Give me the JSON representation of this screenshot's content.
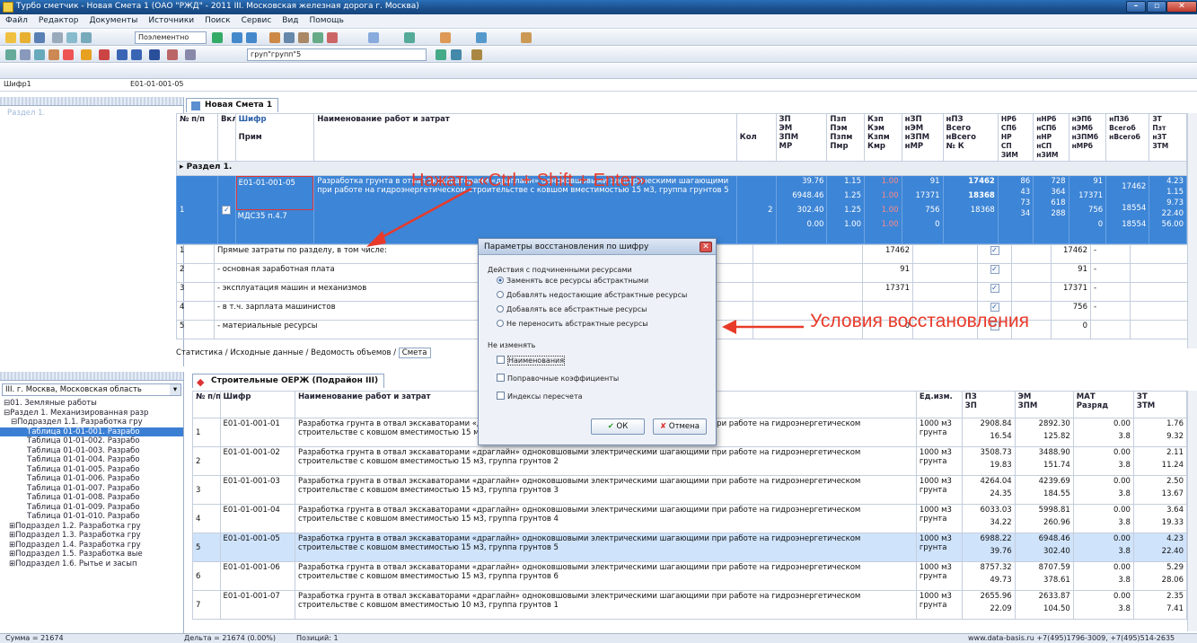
{
  "window": {
    "title": "Турбо сметчик - Новая Смета 1 (ОАО \"РЖД\" - 2011 III. Московская железная дорога г. Москва)",
    "min": "–",
    "max": "▫",
    "close": "✕"
  },
  "menu": [
    "Файл",
    "Редактор",
    "Документы",
    "Источники",
    "Поиск",
    "Сервис",
    "Вид",
    "Помощь"
  ],
  "toolbar": {
    "combo1": "Поэлементно",
    "combo2": "груп\"групп\"5"
  },
  "addr": {
    "label": "Шифр1",
    "value": "E01-01-001-05"
  },
  "left_top": {
    "items": [
      "Раздел 1."
    ]
  },
  "left_bottom": {
    "dropdown": "III. г. Москва, Московская область",
    "tree": [
      "⊟01. Земляные работы",
      "⊟Раздел 1. Механизированная разр",
      "⊟Подраздел 1.1. Разработка гру",
      "Таблица 01-01-001. Разрабо",
      "Таблица 01-01-002. Разрабо",
      "Таблица 01-01-003. Разрабо",
      "Таблица 01-01-004. Разрабо",
      "Таблица 01-01-005. Разрабо",
      "Таблица 01-01-006. Разрабо",
      "Таблица 01-01-007. Разрабо",
      "Таблица 01-01-008. Разрабо",
      "Таблица 01-01-009. Разрабо",
      "Таблица 01-01-010. Разрабо",
      "⊞Подраздел 1.2. Разработка гру",
      "⊞Подраздел 1.3. Разработка гру",
      "⊞Подраздел 1.4. Разработка гру",
      "⊞Подраздел 1.5. Разработка вые",
      "⊞Подраздел 1.6. Рытье и засып"
    ]
  },
  "top_tab": "Новая Смета 1",
  "top_header": {
    "no": "№ п/п",
    "vkl": "Вкл",
    "shifr": "Шифр",
    "prim": "Прим",
    "name": "Наименование работ и затрат",
    "kol": "Кол",
    "c1": [
      "ЗП",
      "ЭМ",
      "ЗПМ",
      "МР"
    ],
    "c2": [
      "Пзп",
      "Пэм",
      "Пзпм",
      "Пмр"
    ],
    "c3": [
      "Кзп",
      "Кэм",
      "Кзпм",
      "Кмр"
    ],
    "c4": [
      "нЗП",
      "нЭМ",
      "нЗПМ",
      "нМР"
    ],
    "c5": [
      "нПЗ",
      "Всего",
      "нВсего",
      "№ К"
    ],
    "c6": [
      "НРб",
      "СПб",
      "НР",
      "СП",
      "ЗИМ"
    ],
    "c7": [
      "нНРб",
      "нСПб",
      "нНР",
      "нСП",
      "нЗИМ"
    ],
    "c8": [
      "нЭПб",
      "нЭМб",
      "нЗПМб",
      "нМРб"
    ],
    "c9": [
      "нПЗб",
      "Всегоб",
      "нВсегоб"
    ],
    "c10": [
      "ЗТ",
      "Пзт",
      "нЗТ",
      "ЗТМ",
      "нЗТМ"
    ]
  },
  "section_label": "Раздел 1.",
  "main_row": {
    "no": "1",
    "code": "E01-01-001-05",
    "prim": "МДС35 п.4.7",
    "name": "Разработка грунта в отвал экскаваторами «драглайн» одноковшовыми электрическими шагающими при работе на гидроэнергетическом строительстве с ковшом вместимостью 15 м3, группа грунтов 5",
    "kol": "2",
    "c1": [
      "39.76",
      "6948.46",
      "302.40",
      "0.00"
    ],
    "c2": [
      "1.15",
      "1.25",
      "1.25",
      "1.00"
    ],
    "c3": [
      "1.00",
      "1.00",
      "1.00",
      "1.00"
    ],
    "c4": [
      "91",
      "17371",
      "756",
      "0"
    ],
    "c5": [
      "17462",
      "18368",
      "18368"
    ],
    "c6": [
      "86",
      "43",
      "73",
      "34"
    ],
    "c7": [
      "728",
      "364",
      "618",
      "288"
    ],
    "c8": [
      "91",
      "17371",
      "756",
      "0"
    ],
    "c9": [
      "17462",
      "18554",
      "18554"
    ],
    "c10": [
      "4.23",
      "1.15",
      "9.73",
      "22.40",
      "56.00"
    ]
  },
  "summary_rows": [
    {
      "no": "1",
      "label": "Прямые затраты по разделу, в том числе:",
      "v": "17462",
      "b": "17462",
      "z": "-"
    },
    {
      "no": "2",
      "label": "- основная заработная плата",
      "v": "91",
      "b": "91",
      "z": "-"
    },
    {
      "no": "3",
      "label": "- эксплуатация машин и механизмов",
      "v": "17371",
      "b": "17371",
      "z": "-"
    },
    {
      "no": "4",
      "label": "- в т.ч. зарплата машинистов",
      "v": "",
      "b": "756",
      "z": "-"
    },
    {
      "no": "5",
      "label": "- материальные ресурсы",
      "v": "0",
      "b": "0",
      "z": ""
    }
  ],
  "bottom_tabs": [
    "Статистика",
    "Исходные данные",
    "Ведомость объемов",
    "Смета"
  ],
  "norm_tab": "Строительные ОЕРЖ (Подрайон III)",
  "norm_header": {
    "no": "№ п/п",
    "shifr": "Шифр",
    "name": "Наименование работ и затрат",
    "unit": "Ед.изм.",
    "pz": "ПЗ",
    "zp": "ЗП",
    "em": "ЭМ",
    "zpm": "ЗПМ",
    "mat": "МАТ",
    "razr": "Разряд",
    "zt": "ЗТ",
    "ztm": "ЗТМ"
  },
  "norm_rows": [
    {
      "no": "1",
      "code": "E01-01-001-01",
      "l1": "Разработка грунта в отвал экскаваторами «драглайн» одноковшовыми электрическими шагающими при работе на гидроэнергетическом",
      "l2": "строительстве с ковшом вместимостью 15 м3, группа грунтов 1",
      "u1": "1000 м3",
      "u2": "грунта",
      "pz": "2908.84",
      "zp": "16.54",
      "em": "2892.30",
      "zpm": "125.82",
      "mat": "0.00",
      "razr": "3.8",
      "zt": "1.76",
      "ztm": "9.32"
    },
    {
      "no": "2",
      "code": "E01-01-001-02",
      "l1": "Разработка грунта в отвал экскаваторами «драглайн» одноковшовыми электрическими шагающими при работе на гидроэнергетическом",
      "l2": "строительстве с ковшом вместимостью 15 м3, группа грунтов 2",
      "u1": "1000 м3",
      "u2": "грунта",
      "pz": "3508.73",
      "zp": "19.83",
      "em": "3488.90",
      "zpm": "151.74",
      "mat": "0.00",
      "razr": "3.8",
      "zt": "2.11",
      "ztm": "11.24"
    },
    {
      "no": "3",
      "code": "E01-01-001-03",
      "l1": "Разработка грунта в отвал экскаваторами «драглайн» одноковшовыми электрическими шагающими при работе на гидроэнергетическом",
      "l2": "строительстве с ковшом вместимостью 15 м3, группа грунтов 3",
      "u1": "1000 м3",
      "u2": "грунта",
      "pz": "4264.04",
      "zp": "24.35",
      "em": "4239.69",
      "zpm": "184.55",
      "mat": "0.00",
      "razr": "3.8",
      "zt": "2.50",
      "ztm": "13.67"
    },
    {
      "no": "4",
      "code": "E01-01-001-04",
      "l1": "Разработка грунта в отвал экскаваторами «драглайн» одноковшовыми электрическими шагающими при работе на гидроэнергетическом",
      "l2": "строительстве с ковшом вместимостью 15 м3, группа грунтов 4",
      "u1": "1000 м3",
      "u2": "грунта",
      "pz": "6033.03",
      "zp": "34.22",
      "em": "5998.81",
      "zpm": "260.96",
      "mat": "0.00",
      "razr": "3.8",
      "zt": "3.64",
      "ztm": "19.33"
    },
    {
      "no": "5",
      "code": "E01-01-001-05",
      "l1": "Разработка грунта в отвал экскаваторами «драглайн» одноковшовыми электрическими шагающими при работе на гидроэнергетическом",
      "l2": "строительстве с ковшом вместимостью 15 м3, группа грунтов 5",
      "u1": "1000 м3",
      "u2": "грунта",
      "pz": "6988.22",
      "zp": "39.76",
      "em": "6948.46",
      "zpm": "302.40",
      "mat": "0.00",
      "razr": "3.8",
      "zt": "4.23",
      "ztm": "22.40"
    },
    {
      "no": "6",
      "code": "E01-01-001-06",
      "l1": "Разработка грунта в отвал экскаваторами «драглайн» одноковшовыми электрическими шагающими при работе на гидроэнергетическом",
      "l2": "строительстве с ковшом вместимостью 15 м3, группа грунтов 6",
      "u1": "1000 м3",
      "u2": "грунта",
      "pz": "8757.32",
      "zp": "49.73",
      "em": "8707.59",
      "zpm": "378.61",
      "mat": "0.00",
      "razr": "3.8",
      "zt": "5.29",
      "ztm": "28.06"
    },
    {
      "no": "7",
      "code": "E01-01-001-07",
      "l1": "Разработка грунта в отвал экскаваторами «драглайн» одноковшовыми электрическими шагающими при работе на гидроэнергетическом",
      "l2": "строительстве с ковшом вместимостью 10 м3, группа грунтов 1",
      "u1": "1000 м3",
      "u2": "грунта",
      "pz": "2655.96",
      "zp": "22.09",
      "em": "2633.87",
      "zpm": "104.50",
      "mat": "0.00",
      "razr": "3.8",
      "zt": "2.35",
      "ztm": "7.41"
    }
  ],
  "dialog": {
    "title": "Параметры восстановления по шифру",
    "group1": "Действия с подчиненными ресурсами",
    "opts": [
      "Заменять все ресурсы абстрактными",
      "Добавлять недостающие абстрактные ресурсы",
      "Добавлять все абстрактные ресурсы",
      "Не переносить абстрактные ресурсы"
    ],
    "group2": "Не изменять",
    "checks": [
      "Наименования",
      "Поправочные коэффициенты",
      "Индексы пересчета"
    ],
    "ok": "ОК",
    "cancel": "Отмена"
  },
  "annotations": {
    "top": "Нажать «Ctrl + Shift + Enter»",
    "right": "Условия восстановления"
  },
  "status": {
    "sum": "Сумма = 21674",
    "delta": "Дельта = 21674 (0.00%)",
    "pos": "Позиций: 1",
    "site": "www.data-basis.ru  +7(495)1796-3009, +7(495)514-2635"
  },
  "colors": {
    "accent": "#3d85d6",
    "annotation": "#e83a2a"
  }
}
